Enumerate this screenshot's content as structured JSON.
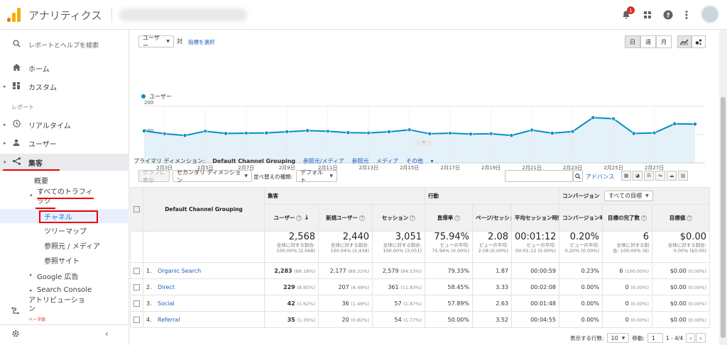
{
  "app": {
    "title": "アナリティクス",
    "notification_count": "1"
  },
  "sidebar": {
    "search_placeholder": "レポートとヘルプを検索",
    "home": "ホーム",
    "custom": "カスタム",
    "report_header": "レポート",
    "realtime": "リアルタイム",
    "audience": "ユーザー",
    "acquisition": "集客",
    "overview": "概要",
    "all_traffic": "すべてのトラフィ\nック",
    "all_traffic_l1": "すべてのトラフィ",
    "all_traffic_l2": "ック",
    "channels": "チャネル",
    "treemap": "ツリーマップ",
    "source_medium": "参照元 / メディア",
    "referrals": "参照サイト",
    "google_ads": "Google 広告",
    "search_console": "Search Console",
    "attribution_l1": "アトリビューショ",
    "attribution_l2": "ン",
    "beta": "ベータ版"
  },
  "controls": {
    "metric_select": "ユーザー",
    "vs": "対",
    "select_metric": "指標を選択",
    "period_day": "日",
    "period_week": "週",
    "period_month": "月"
  },
  "chart_data": {
    "type": "line",
    "series": [
      {
        "name": "ユーザー",
        "values": [
          113,
          103,
          97,
          112,
          104,
          105,
          106,
          110,
          114,
          112,
          107,
          106,
          110,
          117,
          103,
          105,
          102,
          103,
          97,
          116,
          105,
          111,
          160,
          156,
          104,
          106,
          138,
          137
        ]
      }
    ],
    "x_tick_labels": [
      "2月3日",
      "2月5日",
      "2月7日",
      "2月9日",
      "2月11日",
      "2月13日",
      "2月15日",
      "2月17日",
      "2月19日",
      "2月21日",
      "2月23日",
      "2月25日",
      "2月27日"
    ],
    "y_tick_labels": [
      "200",
      "100"
    ],
    "ylim": [
      0,
      200
    ],
    "color": "#058dc7",
    "fill": "#e4f1f9"
  },
  "dimension_bar": {
    "label": "プライマリ ディメンション:",
    "active": "Default Channel Grouping",
    "options": [
      "参照元/メディア",
      "参照元",
      "メディア",
      "その他"
    ]
  },
  "toolbar": {
    "plot_rows": "グラフに表示",
    "secondary_dim": "セカンダリ ディメンション",
    "sort_type_label": "並べ替えの種類:",
    "sort_type": "デフォルト",
    "advanced": "アドバンス"
  },
  "table": {
    "dim_header": "Default Channel Grouping",
    "groups": {
      "acquisition": "集客",
      "behavior": "行動",
      "conversion": "コンバージョン",
      "goal_select": "すべての目標"
    },
    "columns": [
      "ユーザー",
      "新規ユーザー",
      "セッション",
      "直帰率",
      "ページ/セッション",
      "平均セッション時間",
      "コンバージョン率",
      "目標の完了数",
      "目標値"
    ],
    "totals": [
      {
        "big": "2,568",
        "s1": "全体に対する割合:",
        "s2": "100.00% (2,568)"
      },
      {
        "big": "2,440",
        "s1": "全体に対する割合:",
        "s2": "100.04% (2,439)"
      },
      {
        "big": "3,051",
        "s1": "全体に対する割合:",
        "s2": "100.00% (3,051)"
      },
      {
        "big": "75.94%",
        "s1": "ビューの平均:",
        "s2": "75.94% (0.00%)"
      },
      {
        "big": "2.08",
        "s1": "ビューの平均:",
        "s2": "2.08 (0.00%)"
      },
      {
        "big": "00:01:12",
        "s1": "ビューの平均:",
        "s2": "00:01:12 (0.00%)"
      },
      {
        "big": "0.20%",
        "s1": "ビューの平均:",
        "s2": "0.20% (0.00%)"
      },
      {
        "big": "6",
        "s1": "全体に対する割",
        "s2": "合: 100.00% (6)"
      },
      {
        "big": "$0.00",
        "s1": "全体に対する割合:",
        "s2": "0.00% ($0.00)"
      }
    ],
    "rows": [
      {
        "idx": "1.",
        "name": "Organic Search",
        "users": "2,283",
        "users_pct": "(88.18%)",
        "new": "2,177",
        "new_pct": "(89.22%)",
        "sessions": "2,579",
        "sessions_pct": "(84.53%)",
        "bounce": "79.33%",
        "pps": "1.87",
        "dur": "00:00:59",
        "cr": "0.23%",
        "goals": "6",
        "goals_pct": "(100.00%)",
        "value": "$0.00",
        "value_pct": "(0.00%)"
      },
      {
        "idx": "2.",
        "name": "Direct",
        "users": "229",
        "users_pct": "(8.85%)",
        "new": "207",
        "new_pct": "(8.48%)",
        "sessions": "361",
        "sessions_pct": "(11.83%)",
        "bounce": "58.45%",
        "pps": "3.33",
        "dur": "00:02:08",
        "cr": "0.00%",
        "goals": "0",
        "goals_pct": "(0.00%)",
        "value": "$0.00",
        "value_pct": "(0.00%)"
      },
      {
        "idx": "3.",
        "name": "Social",
        "users": "42",
        "users_pct": "(1.62%)",
        "new": "36",
        "new_pct": "(1.48%)",
        "sessions": "57",
        "sessions_pct": "(1.87%)",
        "bounce": "57.89%",
        "pps": "2.63",
        "dur": "00:01:48",
        "cr": "0.00%",
        "goals": "0",
        "goals_pct": "(0.00%)",
        "value": "$0.00",
        "value_pct": "(0.00%)"
      },
      {
        "idx": "4.",
        "name": "Referral",
        "users": "35",
        "users_pct": "(1.35%)",
        "new": "20",
        "new_pct": "(0.82%)",
        "sessions": "54",
        "sessions_pct": "(1.77%)",
        "bounce": "50.00%",
        "pps": "3.52",
        "dur": "00:04:55",
        "cr": "0.00%",
        "goals": "0",
        "goals_pct": "(0.00%)",
        "value": "$0.00",
        "value_pct": "(0.00%)"
      }
    ]
  },
  "pager": {
    "rows_label": "表示する行数:",
    "rows_value": "10",
    "goto_label": "移動:",
    "goto_value": "1",
    "range": "1 - 4/4"
  }
}
